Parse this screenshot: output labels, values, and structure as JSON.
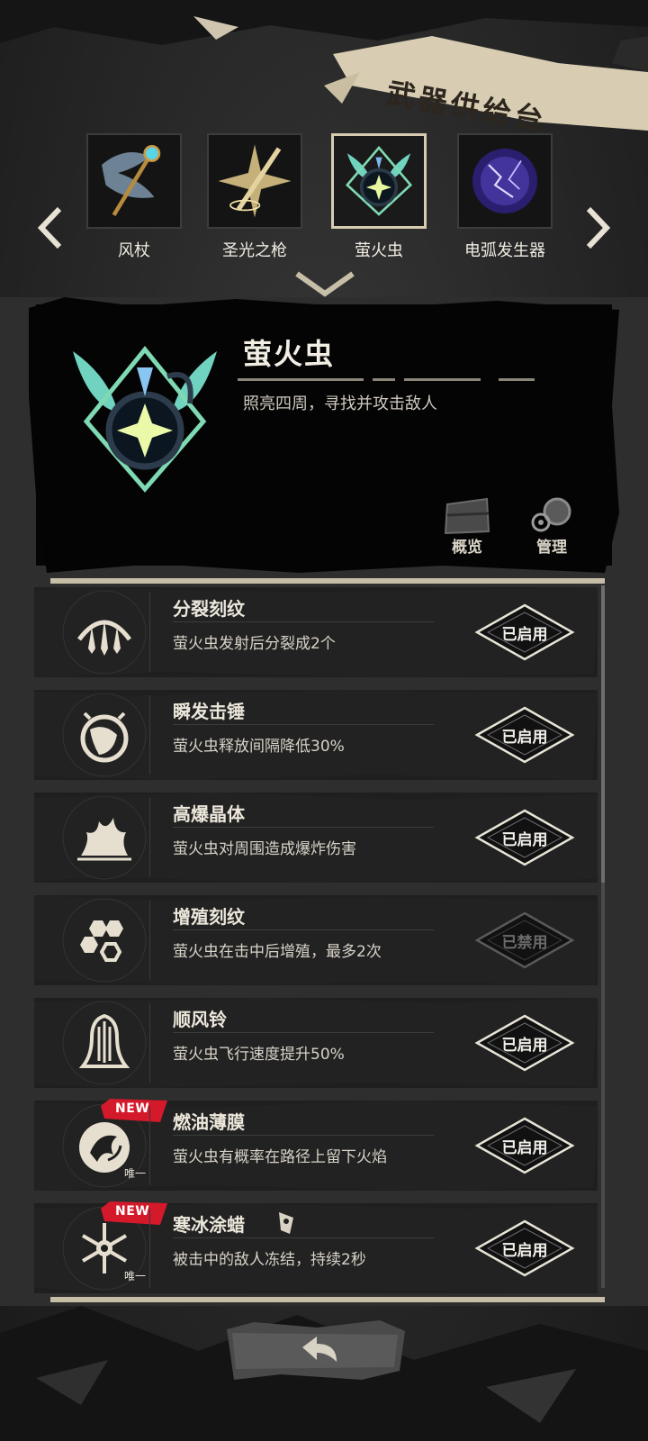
{
  "header": {
    "title": "武器供给台"
  },
  "selector": {
    "weapons": [
      {
        "name": "风杖",
        "active": false
      },
      {
        "name": "圣光之枪",
        "active": false
      },
      {
        "name": "萤火虫",
        "active": true
      },
      {
        "name": "电弧发生器",
        "active": false
      }
    ],
    "prev_icon": "chevron-left-icon",
    "next_icon": "chevron-right-icon"
  },
  "detail": {
    "name": "萤火虫",
    "description": "照亮四周，寻找并攻击敌人",
    "overview_label": "概览",
    "manage_label": "管理"
  },
  "runes": [
    {
      "name": "分裂刻纹",
      "desc": "萤火虫发射后分裂成2个",
      "status": "已启用",
      "enabled": true,
      "icon": "split-icon",
      "new": false,
      "unique": false
    },
    {
      "name": "瞬发击锤",
      "desc": "萤火虫释放间隔降低30%",
      "status": "已启用",
      "enabled": true,
      "icon": "timer-icon",
      "new": false,
      "unique": false
    },
    {
      "name": "高爆晶体",
      "desc": "萤火虫对周围造成爆炸伤害",
      "status": "已启用",
      "enabled": true,
      "icon": "explosion-icon",
      "new": false,
      "unique": false
    },
    {
      "name": "增殖刻纹",
      "desc": "萤火虫在击中后增殖，最多2次",
      "status": "已禁用",
      "enabled": false,
      "icon": "hexagon-cluster-icon",
      "new": false,
      "unique": false
    },
    {
      "name": "顺风铃",
      "desc": "萤火虫飞行速度提升50%",
      "status": "已启用",
      "enabled": true,
      "icon": "bell-icon",
      "new": false,
      "unique": false
    },
    {
      "name": "燃油薄膜",
      "desc": "萤火虫有概率在路径上留下火焰",
      "status": "已启用",
      "enabled": true,
      "icon": "fire-swirl-icon",
      "new": true,
      "unique": true,
      "new_label": "NEW",
      "unique_label": "唯一"
    },
    {
      "name": "寒冰涂蜡",
      "desc": "被击中的敌人冻结，持续2秒",
      "status": "已启用",
      "enabled": true,
      "icon": "snowflake-icon",
      "new": true,
      "unique": true,
      "new_label": "NEW",
      "unique_label": "唯一"
    }
  ],
  "colors": {
    "accent": "#c7bea8",
    "panel": "#050505",
    "new_badge": "#d4192b",
    "teal": "#5fd3b8"
  }
}
